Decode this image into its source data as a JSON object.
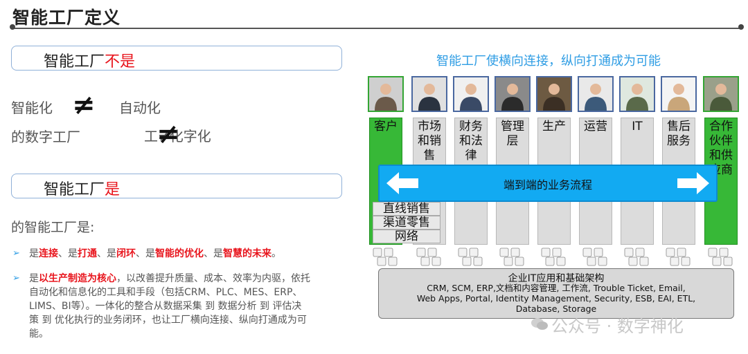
{
  "page_title": "智能工厂定义",
  "section1": {
    "prefix": "智能工厂",
    "highlight": "不是"
  },
  "not_is": {
    "row1_left": "智能化",
    "row1_right": "自动化",
    "row2_left": "的数字工厂",
    "row2_right": "工≠化字化",
    "neq": "≠"
  },
  "section2": {
    "prefix": "智能工厂",
    "highlight": "是"
  },
  "is_intro": "的智能工厂是:",
  "bullet1": {
    "parts": [
      "是",
      "连接",
      "、是",
      "打通",
      "、是",
      "闭环",
      "、是",
      "智能的优化",
      "、是",
      "智慧的未来",
      "。"
    ]
  },
  "bullet2": {
    "lead": "是",
    "highlight": "以生产制造为核心",
    "line1_rest": "，以改善提升质量、成本、效率为内驱，依托",
    "line2": "自动化和信息化的工具和手段（包括CRM、PLC、MES、ERP、",
    "line3": "LIMS、BI等）。一体化的整合从数据采集 到 数据分析 到 评估决",
    "line4": "策 到 优化执行的业务闭环，也让工厂横向连接、纵向打通成为可",
    "line5": "能。"
  },
  "bullet_marker": "➢",
  "right_title": "智能工厂使横向连接，纵向打通成为可能",
  "columns": [
    {
      "label": "客户",
      "lines": [
        "客户"
      ],
      "green": true
    },
    {
      "label": "市场和销售",
      "lines": [
        "市场",
        "和销",
        "售"
      ],
      "green": false
    },
    {
      "label": "财务和法律",
      "lines": [
        "财务",
        "和法",
        "律"
      ],
      "green": false
    },
    {
      "label": "管理层",
      "lines": [
        "管理",
        "层"
      ],
      "green": false
    },
    {
      "label": "生产",
      "lines": [
        "生产"
      ],
      "green": false
    },
    {
      "label": "运营",
      "lines": [
        "运营"
      ],
      "green": false
    },
    {
      "label": "IT",
      "lines": [
        "IT"
      ],
      "green": false
    },
    {
      "label": "售后服务",
      "lines": [
        "售后",
        "服务"
      ],
      "green": false
    },
    {
      "label": "合作伙伴和供应商",
      "lines": [
        "合作",
        "伙伴",
        "和供",
        "应商"
      ],
      "green": true
    }
  ],
  "process_label": "端到端的业务流程",
  "customer_channels": [
    "直线销售",
    "渠道零售",
    "网络"
  ],
  "infra": {
    "title": "企业IT应用和基础架构",
    "desc_line1": "CRM, SCM, ERP,文档和内容管理, 工作流, Trouble Ticket, Email,",
    "desc_line2": "Web Apps, Portal, Identity Management, Security, ESB, EAI, ETL,",
    "desc_line3": "Database, Storage"
  },
  "watermark": "公众号 · 数字神化",
  "colors": {
    "accent_red": "#e8141c",
    "accent_blue": "#2f9de4",
    "process_blue": "#12aaf2",
    "green": "#37b837",
    "gray_col": "#dcdcdc"
  }
}
